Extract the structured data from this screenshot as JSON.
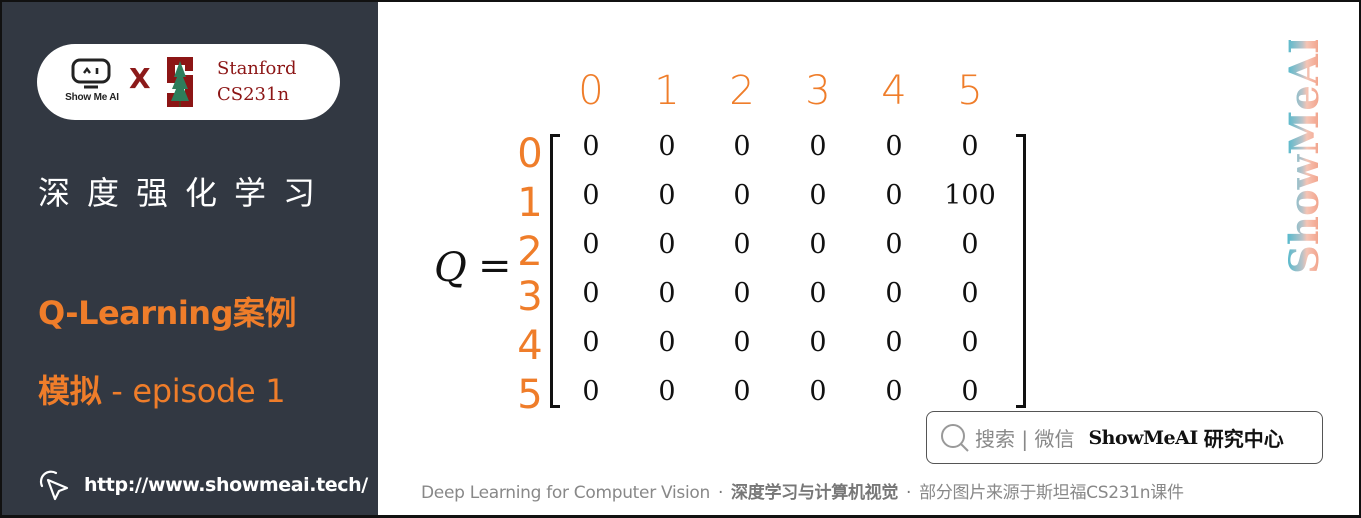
{
  "sidebar": {
    "logo": {
      "showmeai_text": "Show Me AI",
      "x_mark": "X",
      "stanford_line1": "Stanford",
      "stanford_line2": "CS231n"
    },
    "course_title": "深度强化学习",
    "subtitle_line1": "Q-Learning案例",
    "subtitle_line2_cn": "模拟",
    "subtitle_line2_en": " - episode 1",
    "url": "http://www.showmeai.tech/",
    "colors": {
      "panel_bg": "#323842",
      "accent": "#ef7d2a",
      "stanford_red": "#8c1515"
    }
  },
  "matrix": {
    "label": "Q",
    "equals": "=",
    "col_headers": [
      "0",
      "1",
      "2",
      "3",
      "4",
      "5"
    ],
    "row_headers": [
      "0",
      "1",
      "2",
      "3",
      "4",
      "5"
    ],
    "rows": [
      [
        "0",
        "0",
        "0",
        "0",
        "0",
        "0"
      ],
      [
        "0",
        "0",
        "0",
        "0",
        "0",
        "100"
      ],
      [
        "0",
        "0",
        "0",
        "0",
        "0",
        "0"
      ],
      [
        "0",
        "0",
        "0",
        "0",
        "0",
        "0"
      ],
      [
        "0",
        "0",
        "0",
        "0",
        "0",
        "0"
      ],
      [
        "0",
        "0",
        "0",
        "0",
        "0",
        "0"
      ]
    ]
  },
  "brand_vertical": "ShowMeAI",
  "search": {
    "icon": "search-icon",
    "hint": "搜索 | 微信",
    "brand": "ShowMeAI",
    "brand_cn": "研究中心"
  },
  "footer": {
    "part1": "Deep Learning for Computer Vision",
    "sep": "·",
    "part2": "深度学习与计算机视觉",
    "part3": "部分图片来源于斯坦福CS231n课件"
  }
}
